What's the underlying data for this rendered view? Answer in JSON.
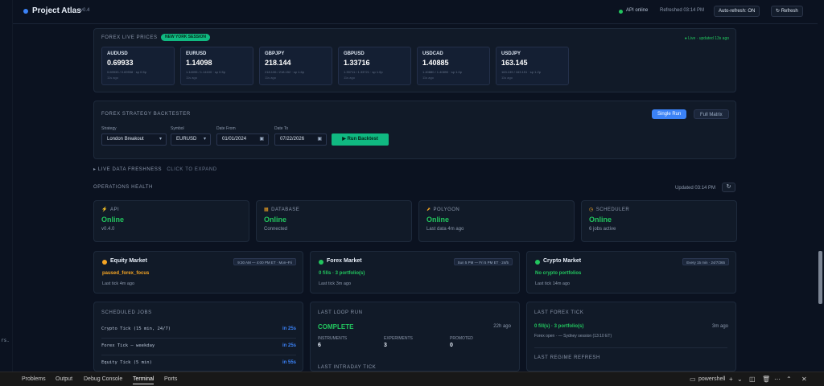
{
  "left_gutter": {
    "mark": "rs."
  },
  "header": {
    "title": "Project Atlas",
    "version": "v0.4",
    "api_status": "API online",
    "refreshed": "Refreshed 03:14 PM",
    "auto_refresh": "Auto-refresh: ON",
    "refresh_button": "↻ Refresh"
  },
  "forex_live": {
    "title": "FOREX LIVE PRICES",
    "session_badge": "NEW YORK SESSION",
    "updated": "● Live · updated 13s ago",
    "cards": [
      {
        "symbol": "AUDUSD",
        "price": "0.69933",
        "sub": "0.69933 / 0.69938 · sp 0.5p",
        "ago": "11s ago"
      },
      {
        "symbol": "EURUSD",
        "price": "1.14098",
        "sub": "1.14095 / 1.14100 · sp 0.5p",
        "ago": "11s ago"
      },
      {
        "symbol": "GBPJPY",
        "price": "218.144",
        "sub": "218.136 / 218.152 · sp 1.6p",
        "ago": "11s ago"
      },
      {
        "symbol": "GBPUSD",
        "price": "1.33716",
        "sub": "1.33711 / 1.33721 · sp 1.0p",
        "ago": "11s ago"
      },
      {
        "symbol": "USDCAD",
        "price": "1.40885",
        "sub": "1.40880 / 1.40890 · sp 1.0p",
        "ago": "11s ago"
      },
      {
        "symbol": "USDJPY",
        "price": "163.145",
        "sub": "163.139 / 163.151 · sp 1.2p",
        "ago": "11s ago"
      }
    ]
  },
  "backtester": {
    "title": "FOREX STRATEGY BACKTESTER",
    "single_run": "Single Run",
    "full_matrix": "Full Matrix",
    "strategy_label": "Strategy",
    "strategy_value": "London Breakout",
    "symbol_label": "Symbol",
    "symbol_value": "EURUSD",
    "date_from_label": "Date From",
    "date_from_value": "01/01/2024",
    "date_to_label": "Date To",
    "date_to_value": "07/22/2026",
    "run_button": "▶ Run Backtest"
  },
  "freshness": {
    "label": "▸ LIVE DATA FRESHNESS",
    "hint": "CLICK TO EXPAND"
  },
  "ops": {
    "title": "OPERATIONS HEALTH",
    "updated": "Updated 03:14 PM",
    "refresh_icon": "↻",
    "health": [
      {
        "icon": "⚡",
        "name": "API",
        "status": "Online",
        "detail": "v0.4.0"
      },
      {
        "icon": "▦",
        "name": "DATABASE",
        "status": "Online",
        "detail": "Connected"
      },
      {
        "icon": "⬈",
        "name": "POLYGON",
        "status": "Online",
        "detail": "Last data 4m ago"
      },
      {
        "icon": "◷",
        "name": "SCHEDULER",
        "status": "Online",
        "detail": "6 jobs active"
      }
    ]
  },
  "markets": [
    {
      "name": "Equity Market",
      "hours": "9:30 AM — 4:00 PM ET · Mon–Fri",
      "line": "paused_forex_focus",
      "tick": "Last tick 4m ago",
      "dot": "#f5a524",
      "line_color": "#f5a524"
    },
    {
      "name": "Forex Market",
      "hours": "Sun 5 PM — Fri 5 PM ET · 24/5",
      "line": "0 fills · 3 portfolio(s)",
      "tick": "Last tick 3m ago",
      "dot": "#22c55e",
      "line_color": "#22c55e"
    },
    {
      "name": "Crypto Market",
      "hours": "Every 15 min · 24/7/365",
      "line": "No crypto portfolios",
      "tick": "Last tick 14m ago",
      "dot": "#22c55e",
      "line_color": "#22c55e"
    }
  ],
  "jobs": {
    "title": "SCHEDULED JOBS",
    "rows": [
      {
        "name": "Crypto Tick (15 min, 24/7)",
        "eta": "in 25s"
      },
      {
        "name": "Forex Tick — weekday",
        "eta": "in 25s"
      },
      {
        "name": "Equity Tick (5 min)",
        "eta": "in 55s"
      }
    ]
  },
  "loop": {
    "title": "LAST LOOP RUN",
    "status": "COMPLETE",
    "ago": "22h ago",
    "stats": [
      {
        "label": "INSTRUMENTS",
        "value": "6"
      },
      {
        "label": "EXPERIMENTS",
        "value": "3"
      },
      {
        "label": "PROMOTED",
        "value": "0"
      }
    ],
    "next_title": "LAST INTRADAY TICK"
  },
  "forex_tick": {
    "title": "LAST FOREX TICK",
    "line": "0 fill(s) · 3 portfolio(s)",
    "ago": "3m ago",
    "detail": "Forex open · — Sydney session (13:10 ET)",
    "next_title": "LAST REGIME REFRESH"
  },
  "statusbar": {
    "tabs": [
      "Problems",
      "Output",
      "Debug Console",
      "Terminal",
      "Ports"
    ],
    "active": "Terminal",
    "shell": "powershell"
  }
}
